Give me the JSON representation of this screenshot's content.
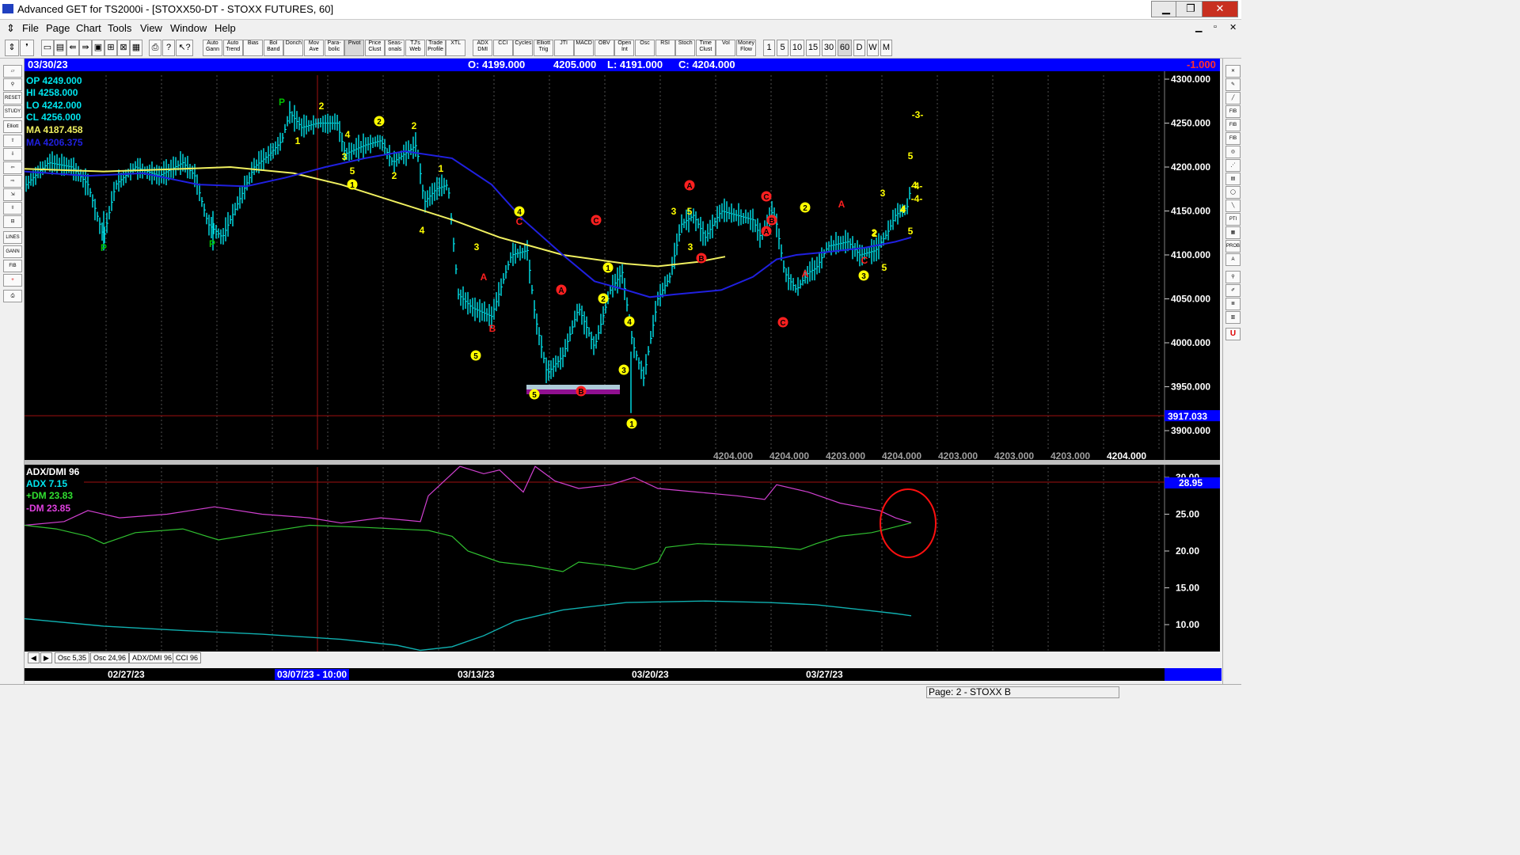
{
  "window": {
    "title": "Advanced GET for TS2000i - [STOXX50-DT - STOXX FUTURES, 60]",
    "controls": [
      "▁",
      "❐",
      "✕"
    ],
    "inner_controls": [
      "▁",
      "▫",
      "✕"
    ]
  },
  "menu": [
    "File",
    "Page",
    "Chart",
    "Tools",
    "View",
    "Window",
    "Help"
  ],
  "toolbar": {
    "buttons": [
      "Auto Gann",
      "Auto Trend",
      "Bias",
      "Bol Band",
      "Donch",
      "Mov Ave",
      "Para- bolic",
      "Pivot",
      "Price Clust",
      "Seas- onals",
      "TJ's Web",
      "Trade Profile",
      "XTL",
      "ADX DMI",
      "CCI",
      "Cycles",
      "Elliott Trig",
      "JTI",
      "MACD",
      "OBV",
      "Open Int",
      "Osc",
      "RSI",
      "Stoch",
      "Time Clust",
      "Vol",
      "Money Flow"
    ],
    "periods": [
      "1",
      "5",
      "10",
      "15",
      "30",
      "60",
      "D",
      "W",
      "M"
    ]
  },
  "header": {
    "date": "03/30/23",
    "open": "O: 4199.000",
    "high": "4205.000",
    "low": "L: 4191.000",
    "close": "C: 4204.000",
    "change": "-1.000"
  },
  "legend": {
    "op": "OP  4249.000",
    "hi": "HI   4258.000",
    "lo": "LO  4242.000",
    "cl": "CL  4256.000",
    "ma1": "MA  4187.458",
    "ma2": "MA  4206.375"
  },
  "colors": {
    "background": "#000000",
    "bars": "#00e5ee",
    "ma_yellow": "#f0f060",
    "ma_blue": "#2020e0",
    "wave_yellow": "#ffff00",
    "wave_red": "#ff2020",
    "pivot_green": "#00c000",
    "dm_plus": "#30c030",
    "dm_minus": "#d040d0",
    "adx": "#10b0b0",
    "header_blue": "#0000ff"
  },
  "price_panel": {
    "axis_labels": [
      "4300.000",
      "4250.000",
      "4200.000",
      "4150.000",
      "4100.000",
      "4050.000",
      "4000.000",
      "3950.000",
      "3900.000"
    ],
    "hline_value": "3917.033",
    "bottom_values": [
      "4204.000",
      "4204.000",
      "4203.000",
      "4204.000",
      "4203.000",
      "4203.000",
      "4203.000",
      "4204.000"
    ],
    "wave_labels": {
      "pivots": [
        "P",
        "P",
        "P"
      ],
      "yellow_text": [
        "2",
        "1",
        "4",
        "3",
        "5",
        "2",
        "2",
        "1",
        "4",
        "3",
        "5",
        "3",
        "4",
        "5",
        "3",
        "4",
        "5",
        "2",
        "-3-",
        "-4-",
        "-4-",
        "3",
        "4",
        "5",
        "2"
      ],
      "yellow_circled": [
        "2",
        "1",
        "4",
        "5",
        "1",
        "2",
        "4",
        "3",
        "5",
        "1",
        "2",
        "3"
      ],
      "red_text": [
        "A",
        "B",
        "C",
        "A",
        "B",
        "C",
        "C",
        "A"
      ],
      "red_circled": [
        "A",
        "B",
        "C",
        "A",
        "B",
        "C",
        "B",
        "A",
        "C"
      ]
    }
  },
  "indicator_panel": {
    "title": "ADX/DMI 96",
    "adx": "ADX 7.15",
    "plus_dm": "+DM 23.83",
    "minus_dm": "-DM  23.85",
    "axis_labels": [
      "30.00",
      "25.00",
      "20.00",
      "15.00",
      "10.00"
    ],
    "hline_value": "28.95"
  },
  "tabs": [
    "Osc 5,35",
    "Osc 24,96",
    "ADX/DMI 96",
    "CCI 96"
  ],
  "dates": [
    "02/27/23",
    "03/07/23 - 10:00",
    "03/13/23",
    "03/20/23",
    "03/27/23"
  ],
  "status": "Page: 2 - STOXX B",
  "chart_data": {
    "type": "line",
    "x": [
      "02/27/23",
      "03/07/23",
      "03/13/23",
      "03/20/23",
      "03/27/23",
      "03/30/23"
    ],
    "series": [
      {
        "name": "price",
        "values": [
          4200,
          4262,
          4120,
          4060,
          4110,
          4204
        ]
      },
      {
        "name": "MA",
        "values": [
          4198,
          4185,
          4105,
          4088,
          4091,
          4106
        ]
      },
      {
        "name": "MA",
        "values": [
          4195,
          4210,
          4170,
          4055,
          4098,
          4122
        ]
      },
      {
        "name": "+DM",
        "values": [
          23,
          21,
          21,
          18,
          21,
          23.83
        ]
      },
      {
        "name": "-DM",
        "values": [
          24,
          24,
          30,
          28,
          26,
          23.85
        ]
      },
      {
        "name": "ADX",
        "values": [
          11,
          8.5,
          6.5,
          13,
          12.8,
          7.15
        ]
      }
    ],
    "ylim": [
      3880,
      4305
    ]
  }
}
